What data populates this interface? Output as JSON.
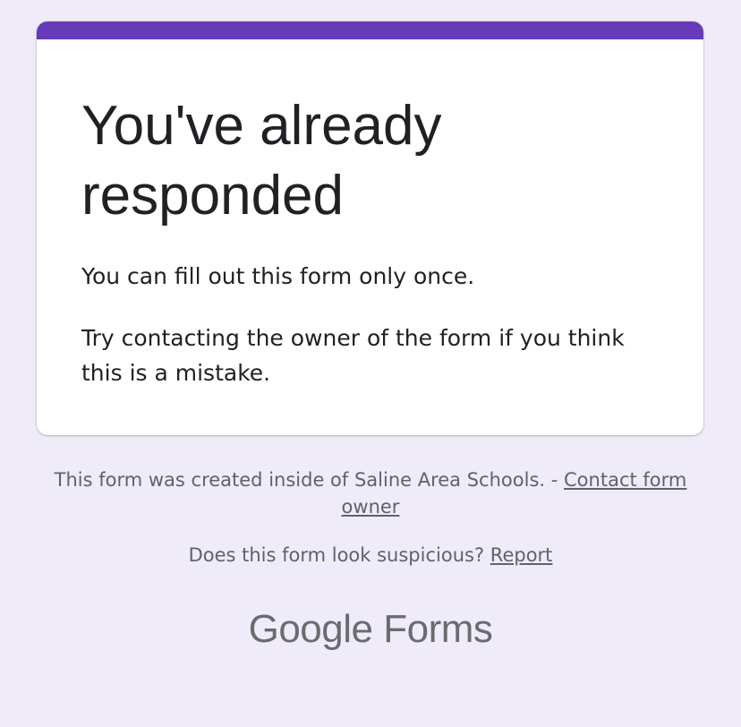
{
  "card": {
    "title": "You've already responded",
    "message1": "You can fill out this form only once.",
    "message2": "Try contacting the owner of the form if you think this is a mistake."
  },
  "footer": {
    "created_text": "This form was created inside of Saline Area Schools. -",
    "contact_link": "Contact form owner",
    "suspicious_text": "Does this form look suspicious?",
    "report_link": "Report"
  },
  "brand": {
    "google": "Google",
    "product": "Forms"
  },
  "colors": {
    "accent": "#673ab7",
    "background": "#efebf8",
    "card": "#ffffff",
    "text": "#202124",
    "muted": "#5f6368"
  }
}
